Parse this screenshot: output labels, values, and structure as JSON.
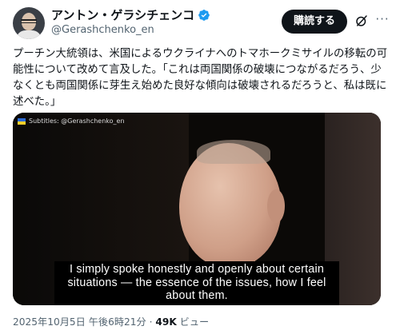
{
  "author": {
    "display_name": "アントン・ゲラシチェンコ",
    "handle": "@Gerashchenko_en",
    "verified": true
  },
  "actions": {
    "subscribe_label": "購読する",
    "grok_icon": "grok-icon",
    "more_icon": "ellipsis-icon",
    "more_glyph": "···"
  },
  "tweet": {
    "text": "プーチン大統領は、米国によるウクライナへのトマホークミサイルの移転の可能性について改めて言及した。「これは両国関係の破壊につながるだろう、少なくとも両国関係に芽生え始めた良好な傾向は破壊されるだろうと、私は既に述べた。」"
  },
  "media": {
    "subtitles_label": "Subtitles: @Gerashchenko_en",
    "caption": "I simply spoke honestly and openly about certain\nsituations — the essence of the issues, how I feel\nabout them."
  },
  "meta": {
    "date_time": "2025年10月5日 午後6時21分",
    "separator": " · ",
    "views_count": "49K",
    "views_label": " ビュー"
  },
  "colors": {
    "primary_text": "#0f1419",
    "secondary_text": "#536471",
    "verified_blue": "#1d9bf0",
    "button_bg": "#0f1419"
  }
}
